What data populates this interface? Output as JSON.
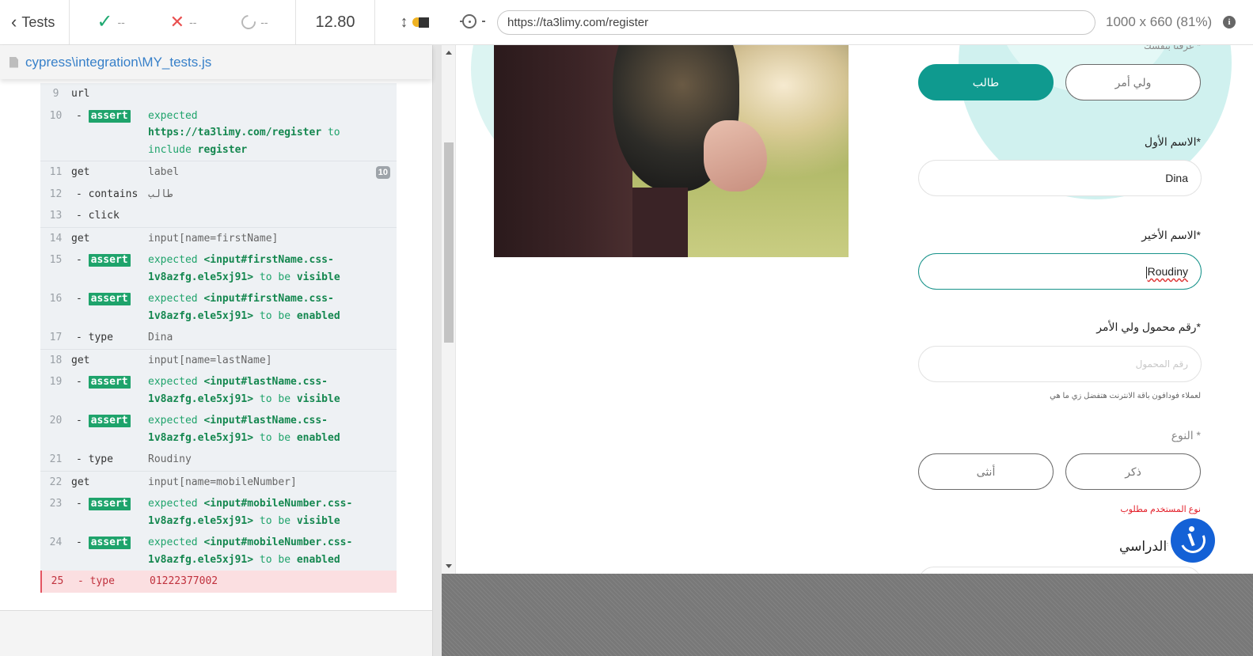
{
  "topbar": {
    "back_label": "Tests",
    "passed": "--",
    "failed": "--",
    "pending": "--",
    "duration": "12.80"
  },
  "file_path": "cypress\\integration\\MY_tests.js",
  "log": [
    {
      "n": "9",
      "cmd": "url"
    },
    {
      "n": "10",
      "cmd": "assert",
      "sub": true,
      "badge": true,
      "parts": [
        [
          "expected ",
          "g"
        ],
        [
          "https://ta3limy.com/register",
          "gb"
        ],
        [
          " to ",
          "g"
        ],
        [
          "include ",
          "g"
        ],
        [
          "register",
          "gb"
        ]
      ]
    },
    {
      "n": "11",
      "cmd": "get",
      "sep": true,
      "msg": "label",
      "count": "10"
    },
    {
      "n": "12",
      "cmd": "contains",
      "sub": true,
      "msg": "طالب"
    },
    {
      "n": "13",
      "cmd": "click",
      "sub": true
    },
    {
      "n": "14",
      "cmd": "get",
      "sep": true,
      "msg": "input[name=firstName]"
    },
    {
      "n": "15",
      "cmd": "assert",
      "sub": true,
      "badge": true,
      "parts": [
        [
          "expected ",
          "g"
        ],
        [
          "<input#firstName.css-1v8azfg.ele5xj91>",
          "gb"
        ],
        [
          " to be ",
          "g"
        ],
        [
          "visible",
          "gb"
        ]
      ]
    },
    {
      "n": "16",
      "cmd": "assert",
      "sub": true,
      "badge": true,
      "parts": [
        [
          "expected ",
          "g"
        ],
        [
          "<input#firstName.css-1v8azfg.ele5xj91>",
          "gb"
        ],
        [
          " to be ",
          "g"
        ],
        [
          "enabled",
          "gb"
        ]
      ]
    },
    {
      "n": "17",
      "cmd": "type",
      "sub": true,
      "msg": "Dina"
    },
    {
      "n": "18",
      "cmd": "get",
      "sep": true,
      "msg": "input[name=lastName]"
    },
    {
      "n": "19",
      "cmd": "assert",
      "sub": true,
      "badge": true,
      "parts": [
        [
          "expected ",
          "g"
        ],
        [
          "<input#lastName.css-1v8azfg.ele5xj91>",
          "gb"
        ],
        [
          " to be ",
          "g"
        ],
        [
          "visible",
          "gb"
        ]
      ]
    },
    {
      "n": "20",
      "cmd": "assert",
      "sub": true,
      "badge": true,
      "parts": [
        [
          "expected ",
          "g"
        ],
        [
          "<input#lastName.css-1v8azfg.ele5xj91>",
          "gb"
        ],
        [
          " to be ",
          "g"
        ],
        [
          "enabled",
          "gb"
        ]
      ]
    },
    {
      "n": "21",
      "cmd": "type",
      "sub": true,
      "msg": "Roudiny"
    },
    {
      "n": "22",
      "cmd": "get",
      "sep": true,
      "msg": "input[name=mobileNumber]"
    },
    {
      "n": "23",
      "cmd": "assert",
      "sub": true,
      "badge": true,
      "parts": [
        [
          "expected ",
          "g"
        ],
        [
          "<input#mobileNumber.css-1v8azfg.ele5xj91>",
          "gb"
        ],
        [
          " to be ",
          "g"
        ],
        [
          "visible",
          "gb"
        ]
      ]
    },
    {
      "n": "24",
      "cmd": "assert",
      "sub": true,
      "badge": true,
      "parts": [
        [
          "expected ",
          "g"
        ],
        [
          "<input#mobileNumber.css-1v8azfg.ele5xj91>",
          "gb"
        ],
        [
          " to be ",
          "g"
        ],
        [
          "enabled",
          "gb"
        ]
      ]
    },
    {
      "n": "25",
      "cmd": "type",
      "sub": true,
      "msg": "01222377002",
      "error": true
    }
  ],
  "aut": {
    "url": "https://ta3limy.com/register",
    "viewport": "1000 x 660",
    "zoom": "(81%)",
    "cut_label": "عرفنا بنفسك *",
    "role_student": "طالب",
    "role_parent": "ولي أمر",
    "first_name_label": "الاسم الأول*",
    "first_name_value": "Dina",
    "last_name_label": "الاسم الأخير*",
    "last_name_value": "Roudiny",
    "mobile_label": "رقم محمول ولي الأمر*",
    "mobile_placeholder": "رقم المحمول",
    "mobile_hint": "لعملاء فودافون باقة الانترنت هتفضل زي ما هي",
    "gender_label": "النوع *",
    "gender_male": "ذكر",
    "gender_female": "أنثى",
    "gender_error": "نوع المستخدم مطلوب",
    "education_label": "الدراسي*"
  },
  "colors": {
    "teal": "#0f9a8f",
    "assert_badge": "#1ea36b",
    "error": "#e3202a",
    "a11y_blue": "#1461d6"
  }
}
